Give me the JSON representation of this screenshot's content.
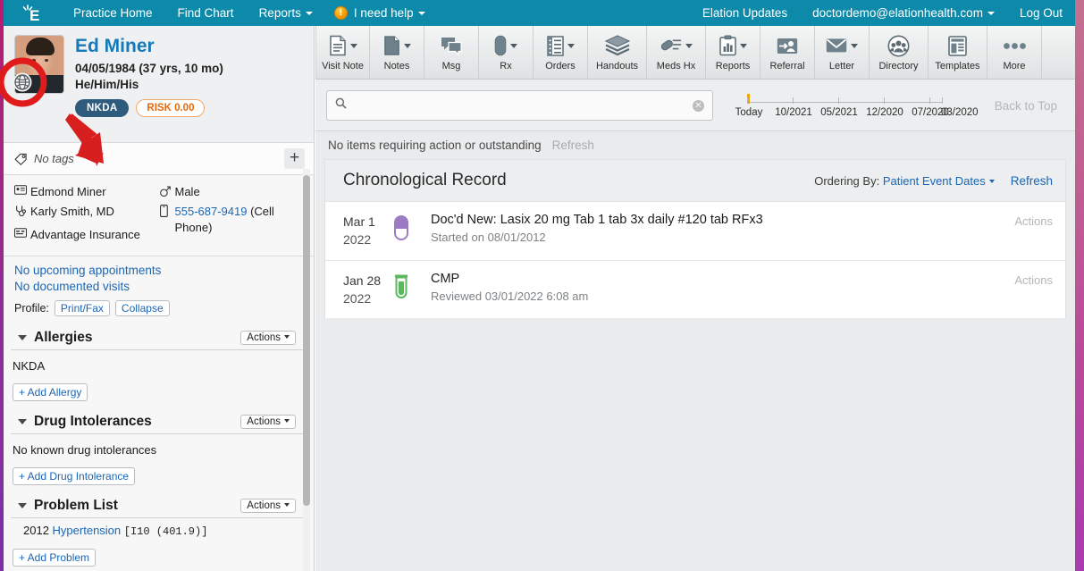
{
  "topnav": {
    "brand_icon": "elation-logo-icon",
    "left_links": [
      {
        "label": "Practice Home",
        "caret": false
      },
      {
        "label": "Find Chart",
        "caret": false
      },
      {
        "label": "Reports",
        "caret": true
      }
    ],
    "help": {
      "icon": "warning-exclamation-icon",
      "label": "I need help",
      "caret": true
    },
    "right_links": [
      {
        "label": "Elation Updates",
        "caret": false
      },
      {
        "label": "doctordemo@elationhealth.com",
        "caret": true
      },
      {
        "label": "Log Out",
        "caret": false
      }
    ],
    "bg_color": "#0d8aa9"
  },
  "patient": {
    "name": "Ed Miner",
    "dob_line": "04/05/1984 (37 yrs, 10 mo)",
    "pronouns": "He/Him/His",
    "avatar_icon": "patient-photo",
    "globe_icon": "globe-icon",
    "badges": [
      {
        "label": "NKDA",
        "color": "#2f5b7d",
        "type": "allergy"
      },
      {
        "label": "RISK 0.00",
        "color": "#e8690a",
        "type": "risk"
      }
    ],
    "tags": {
      "icon": "tag-icon",
      "text": "No tags",
      "add_label": "+"
    },
    "demographics": [
      {
        "icon": "id-card-icon",
        "text": "Edmond Miner",
        "link": false
      },
      {
        "icon": "male-symbol-icon",
        "text": "Male",
        "link": false
      },
      {
        "icon": "stethoscope-icon",
        "text": "Karly Smith, MD",
        "link": false
      },
      {
        "icon": "mobile-phone-icon",
        "text": "555-687-9419",
        "suffix": "(Cell Phone)",
        "link": true
      },
      {
        "icon": "insurance-card-icon",
        "text": "Advantage Insurance",
        "link": false
      }
    ],
    "appointments": [
      "No upcoming appointments",
      "No documented visits"
    ],
    "profile": {
      "label": "Profile:",
      "buttons": [
        "Print/Fax",
        "Collapse"
      ]
    }
  },
  "sections": [
    {
      "title": "Allergies",
      "actions_label": "Actions",
      "body": "NKDA",
      "add_label": "+ Add Allergy"
    },
    {
      "title": "Drug Intolerances",
      "actions_label": "Actions",
      "body": "No known drug intolerances",
      "add_label": "+ Add Drug Intolerance"
    },
    {
      "title": "Problem List",
      "actions_label": "Actions",
      "add_label": "+ Add Problem",
      "problems": [
        {
          "year": "2012",
          "name": "Hypertension",
          "code": "[I10 (401.9)]"
        }
      ]
    }
  ],
  "toolbar": {
    "items": [
      {
        "label": "Visit Note",
        "icon": "visit-note-icon",
        "caret": true
      },
      {
        "label": "Notes",
        "icon": "notes-icon",
        "caret": true
      },
      {
        "label": "Msg",
        "icon": "message-icon",
        "caret": false
      },
      {
        "label": "Rx",
        "icon": "pill-icon",
        "caret": true
      },
      {
        "label": "Orders",
        "icon": "orders-list-icon",
        "caret": true
      },
      {
        "label": "Handouts",
        "icon": "handouts-stack-icon",
        "caret": false
      },
      {
        "label": "Meds Hx",
        "icon": "meds-history-icon",
        "caret": true
      },
      {
        "label": "Reports",
        "icon": "reports-chart-icon",
        "caret": true
      },
      {
        "label": "Referral",
        "icon": "referral-person-icon",
        "caret": false
      },
      {
        "label": "Letter",
        "icon": "envelope-icon",
        "caret": true
      },
      {
        "label": "Directory",
        "icon": "directory-group-icon",
        "caret": false
      },
      {
        "label": "Templates",
        "icon": "templates-layout-icon",
        "caret": false
      },
      {
        "label": "More",
        "icon": "more-dots-icon",
        "caret": false
      }
    ]
  },
  "search": {
    "icon": "search-icon",
    "value": "",
    "placeholder": "",
    "clear_icon": "clear-x-icon"
  },
  "timeline": {
    "marker_color": "#f0a400",
    "labels": [
      "Today",
      "10/2021",
      "05/2021",
      "12/2020",
      "07/2020",
      "03/2020"
    ],
    "back_to_top": "Back to Top"
  },
  "status_bar": {
    "message": "No items requiring action or outstanding",
    "refresh": "Refresh"
  },
  "record": {
    "title": "Chronological Record",
    "ordering_prefix": "Ordering By:",
    "ordering_value": "Patient Event Dates",
    "refresh": "Refresh",
    "rows": [
      {
        "date_day": "Mar 1",
        "date_year": "2022",
        "icon": "pill-capsule-icon",
        "icon_color": "#9b7cc4",
        "title": "Doc'd New: Lasix 20 mg Tab 1 tab 3x daily #120 tab RFx3",
        "sub": "Started on 08/01/2012",
        "actions": "Actions"
      },
      {
        "date_day": "Jan 28",
        "date_year": "2022",
        "icon": "lab-test-tube-icon",
        "icon_color": "#5cb85c",
        "title": "CMP",
        "sub": "Reviewed 03/01/2022 6:08 am",
        "actions": "Actions"
      }
    ]
  },
  "annotation": {
    "circle_color": "#e01b1b",
    "arrow_color": "#d81f1f",
    "target_icon": "globe-icon"
  }
}
